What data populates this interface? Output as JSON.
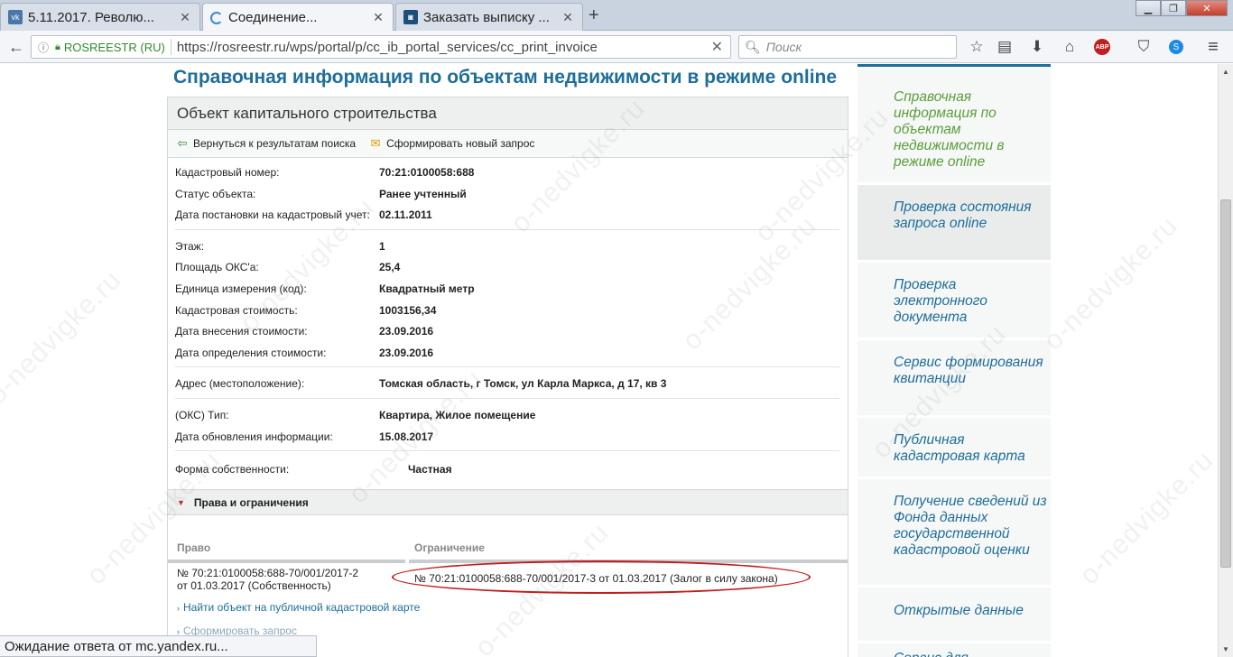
{
  "browser": {
    "tabs": [
      {
        "title": "5.11.2017. Револю...",
        "icon": "vk-icon",
        "active": false
      },
      {
        "title": "Соединение...",
        "icon": "loading-icon",
        "active": true
      },
      {
        "title": "Заказать выписку ...",
        "icon": "site-icon",
        "active": false
      }
    ],
    "new_tab": "+",
    "site_identity": "ROSREESTR (RU)",
    "url": "https://rosreestr.ru/wps/portal/p/cc_ib_portal_services/cc_print_invoice",
    "search_placeholder": "Поиск",
    "status": "Ожидание ответа от mc.yandex.ru...",
    "abp_label": "ABP"
  },
  "page": {
    "heading": "Справочная информация по объектам недвижимости в режиме online",
    "panel_title": "Объект капитального строительства",
    "actions": {
      "back": "Вернуться к результатам поиска",
      "new_query": "Сформировать новый запрос"
    },
    "fields": [
      {
        "label": "Кадастровый номер:",
        "value": "70:21:0100058:688"
      },
      {
        "label": "Статус объекта:",
        "value": "Ранее учтенный"
      },
      {
        "label": "Дата постановки на кадастровый учет:",
        "value": "02.11.2011"
      },
      {
        "label": "Этаж:",
        "value": "1"
      },
      {
        "label": "Площадь ОКС'а:",
        "value": "25,4"
      },
      {
        "label": "Единица измерения (код):",
        "value": "Квадратный метр"
      },
      {
        "label": "Кадастровая стоимость:",
        "value": "1003156,34"
      },
      {
        "label": "Дата внесения стоимости:",
        "value": "23.09.2016"
      },
      {
        "label": "Дата определения стоимости:",
        "value": "23.09.2016"
      },
      {
        "label": "Адрес (местоположение):",
        "value": "Томская область, г Томск, ул Карла Маркса, д 17, кв 3"
      },
      {
        "label": "(ОКС) Тип:",
        "value": "Квартира, Жилое помещение"
      },
      {
        "label": "Дата обновления информации:",
        "value": "15.08.2017"
      },
      {
        "label": "Форма собственности:",
        "value": "Частная"
      }
    ],
    "rights": {
      "section_title": "Права и ограничения",
      "col_right": "Право",
      "col_restriction": "Ограничение",
      "right_line1": "№ 70:21:0100058:688-70/001/2017-2",
      "right_line2": "от 01.03.2017  (Собственность)",
      "restriction": "№ 70:21:0100058:688-70/001/2017-3  от 01.03.2017  (Залог в силу закона)"
    },
    "links": {
      "map": "Найти объект на публичной кадастровой карте",
      "new_query": "Сформировать запрос"
    }
  },
  "sidebar": {
    "items": [
      "Справочная информация по объектам недвижимости в режиме online",
      "Проверка состояния запроса online",
      "Проверка электронного документа",
      "Сервис формирования квитанции",
      "Публичная кадастровая карта",
      "Получение сведений из Фонда данных государственной кадастровой оценки",
      "Открытые данные",
      "Сервис для"
    ]
  },
  "watermark": "o-nedvigke.ru"
}
